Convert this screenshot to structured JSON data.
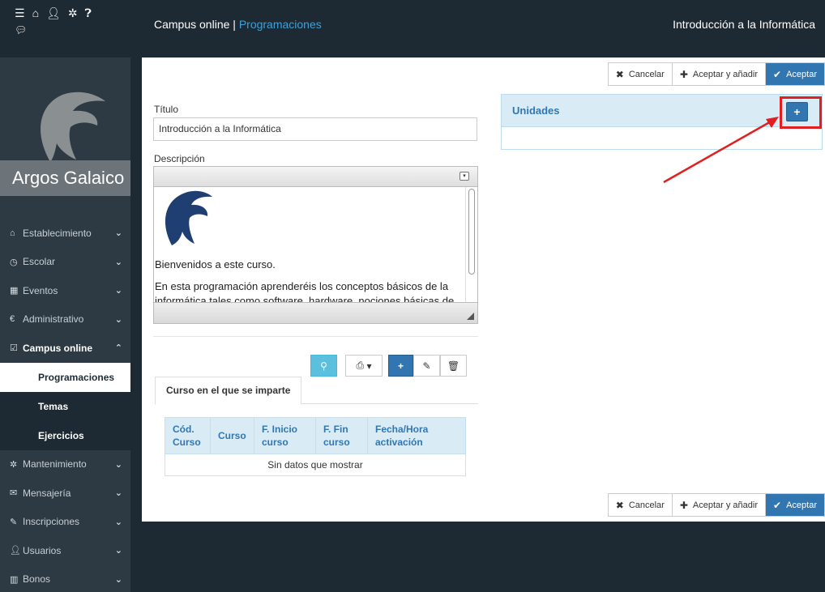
{
  "sidebar": {
    "top_icons": [
      "list-icon",
      "home-icon",
      "user-icon",
      "gear-icon",
      "help-icon"
    ],
    "chat_icon": "chat-icon",
    "brand": "Argos Galaico",
    "menu": [
      {
        "label": "Establecimiento",
        "icon": "home-icon",
        "chev": "⌄"
      },
      {
        "label": "Escolar",
        "icon": "clock-icon",
        "chev": "⌄"
      },
      {
        "label": "Eventos",
        "icon": "calendar-icon",
        "chev": "⌄"
      },
      {
        "label": "Administrativo",
        "icon": "euro-icon",
        "chev": "⌄"
      },
      {
        "label": "Campus online",
        "icon": "check-square-icon",
        "chev": "⌃"
      }
    ],
    "submenu": [
      {
        "label": "Programaciones"
      },
      {
        "label": "Temas"
      },
      {
        "label": "Ejercicios"
      }
    ],
    "menu2": [
      {
        "label": "Mantenimiento",
        "icon": "gear-icon"
      },
      {
        "label": "Mensajería",
        "icon": "envelope-icon"
      },
      {
        "label": "Inscripciones",
        "icon": "pencil-icon"
      },
      {
        "label": "Usuarios",
        "icon": "user-icon"
      },
      {
        "label": "Bonos",
        "icon": "barcode-icon"
      }
    ]
  },
  "header": {
    "crumb_root": "Campus online",
    "crumb_sep": " | ",
    "crumb_link": "Programaciones",
    "course_title": "Introducción a la Informática"
  },
  "actions": {
    "cancel": "Cancelar",
    "accept_add": "Aceptar y añadir",
    "accept": "Aceptar"
  },
  "form": {
    "title_label": "Título",
    "title_value": "Introducción a la Informática",
    "desc_label": "Descripción",
    "desc_p1": "Bienvenidos a este curso.",
    "desc_p2": "En esta programación aprenderéis los conceptos básicos de la informática tales como software, hardware, nociones básicas de"
  },
  "grid": {
    "tab": "Curso en el que se imparte",
    "columns": [
      "Cód. Curso",
      "Curso",
      "F. Inicio curso",
      "F. Fin curso",
      "Fecha/Hora activación"
    ],
    "empty": "Sin datos que mostrar"
  },
  "unidades": {
    "title": "Unidades",
    "add": "+"
  },
  "colors": {
    "primary": "#3276b1",
    "info": "#5bc0de",
    "sidebar": "#2d3a43",
    "topbar": "#1e2a33",
    "highlight": "#e02020"
  }
}
